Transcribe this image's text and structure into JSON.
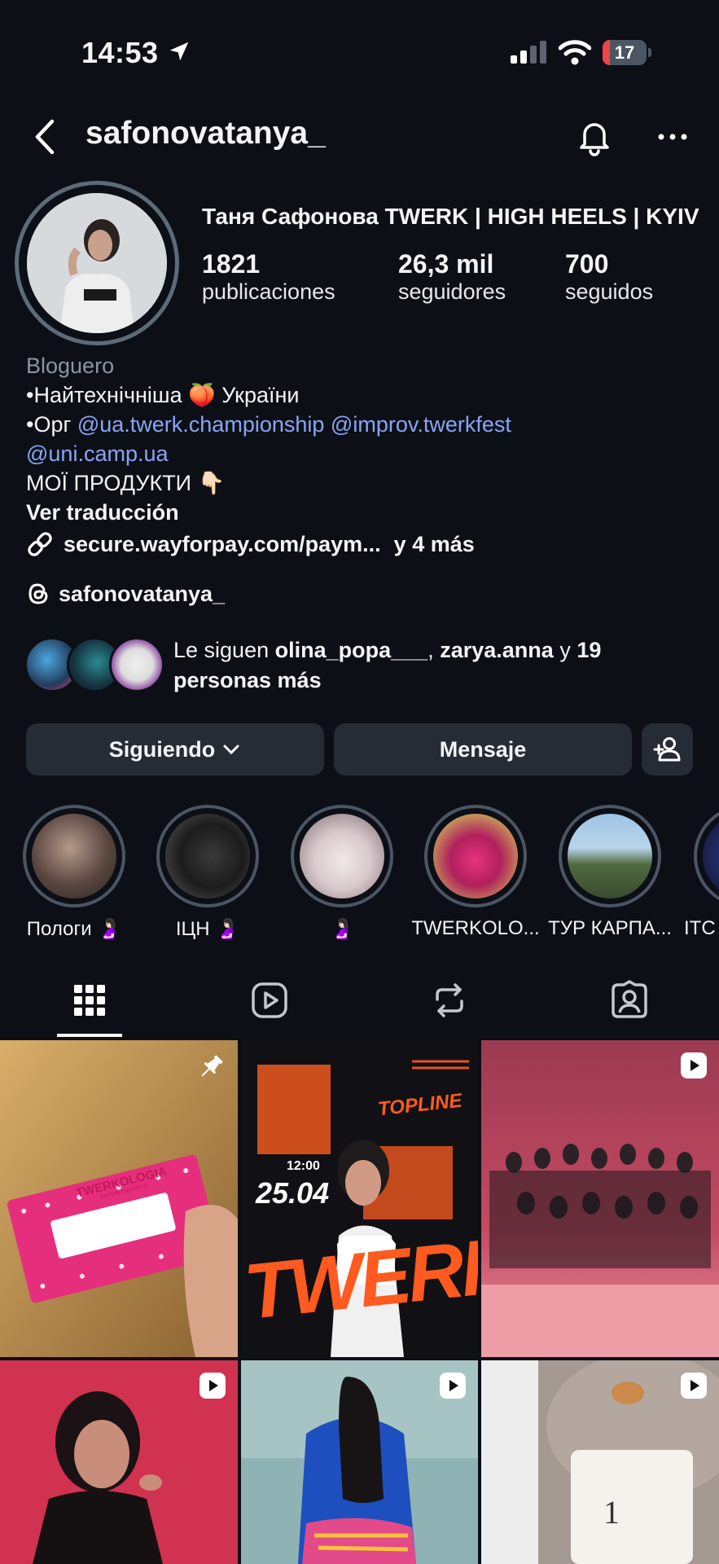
{
  "status_bar": {
    "time": "14:53",
    "battery": 17
  },
  "header": {
    "username": "safonovatanya_"
  },
  "profile": {
    "full_name": "Таня Сафонова TWERK | HIGH HEELS | KYIV",
    "stats": [
      {
        "value": "1821",
        "label": "publicaciones"
      },
      {
        "value": "26,3 mil",
        "label": "seguidores"
      },
      {
        "value": "700",
        "label": "seguidos"
      }
    ],
    "category": "Bloguero",
    "bio_line1": "•Найтехнічніша 🍑 України",
    "bio_line2_prefix": "•Орг",
    "mention1": "@ua.twerk.championship",
    "mention2": "@improv.twerkfest",
    "mention3": "@uni.camp.ua",
    "bio_line4": "МОЇ ПРОДУКТИ 👇🏻",
    "translate": "Ver traducción",
    "link_text": "secure.wayforpay.com/paym...",
    "link_more": "y 4 más",
    "threads_handle": "safonovatanya_",
    "followed_by_prefix": "Le siguen",
    "followed_by_user1": "olina_popa___",
    "followed_by_sep": ",",
    "followed_by_user2": "zarya.anna",
    "followed_by_and": "y",
    "followed_by_rest": "19 personas más"
  },
  "actions": {
    "following": "Siguiendo",
    "message": "Mensaje"
  },
  "highlights": [
    {
      "label": "Пологи 🤰🏻"
    },
    {
      "label": "ІЦН 🤰🏻"
    },
    {
      "label": "🤰🏻"
    },
    {
      "label": "TWERKOLO..."
    },
    {
      "label": "ТУР КАРПА..."
    },
    {
      "label": "ITC"
    }
  ],
  "tabs": [
    "grid-icon",
    "reels-icon",
    "reposts-icon",
    "tagged-icon"
  ],
  "grid": {
    "post1_box_text": "TWERKOLOGIA",
    "post1_box_sub": "SAFONOVATANYA",
    "post2_title": "TWERK",
    "post2_date": "25.04",
    "post2_time": "12:00",
    "post2_top": "TOPLINE"
  },
  "colors": {
    "background": "#0c1016",
    "button": "#262c35",
    "link": "#8aa4f5",
    "battery": "#ef4444"
  }
}
